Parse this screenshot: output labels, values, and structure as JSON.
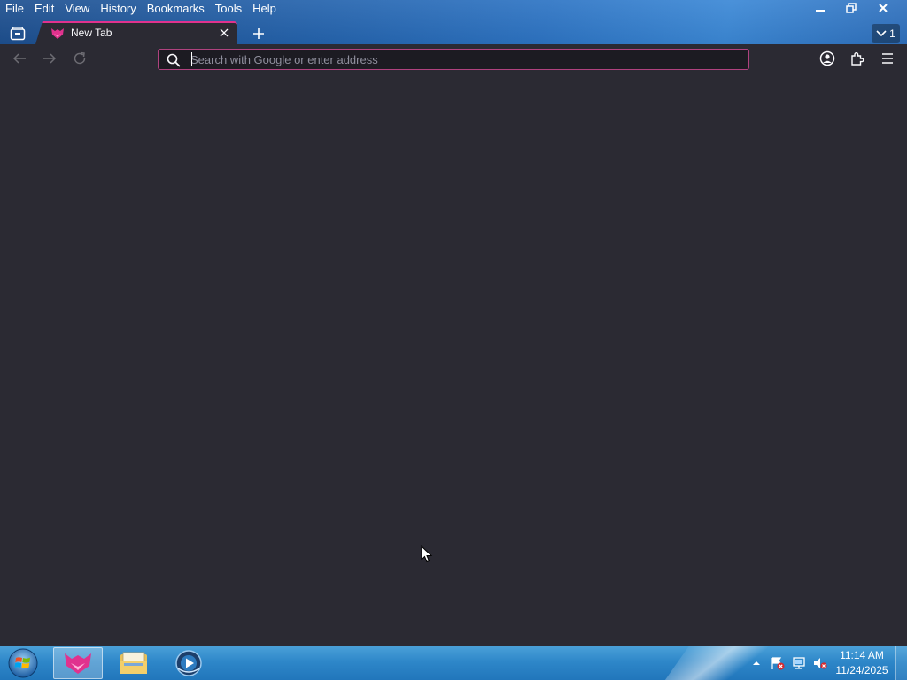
{
  "window": {
    "menu": [
      "File",
      "Edit",
      "View",
      "History",
      "Bookmarks",
      "Tools",
      "Help"
    ],
    "controls": {
      "minimize_icon": "minimize-icon",
      "restore_icon": "restore-icon",
      "close_icon": "close-icon"
    }
  },
  "tabs": {
    "items": [
      {
        "title": "New Tab",
        "favicon": "browser-logo-icon",
        "active": true
      }
    ],
    "new_tab_icon": "plus-icon",
    "tab_count": "1"
  },
  "toolbar": {
    "back_icon": "back-arrow-icon",
    "forward_icon": "forward-arrow-icon",
    "reload_icon": "reload-icon",
    "urlbar": {
      "value": "",
      "placeholder": "Search with Google or enter address"
    },
    "account_icon": "account-icon",
    "extensions_icon": "puzzle-icon",
    "menu_icon": "hamburger-menu-icon"
  },
  "taskbar": {
    "start_icon": "windows-start-icon",
    "apps": [
      {
        "name": "Browser",
        "icon": "browser-logo-icon",
        "active": true
      },
      {
        "name": "File Explorer",
        "icon": "folder-icon",
        "active": false
      },
      {
        "name": "Media Player",
        "icon": "media-player-icon",
        "active": false
      }
    ],
    "tray_icons": [
      "show-hidden-icon",
      "action-center-flag-icon",
      "network-icon",
      "volume-muted-icon"
    ],
    "time": "11:14 AM",
    "date": "11/24/2025"
  },
  "colors": {
    "accent": "#e0328e",
    "chrome_bg": "#2b2a33",
    "urlbar_border": "#b0427f",
    "taskbar": "#2e87c9"
  }
}
